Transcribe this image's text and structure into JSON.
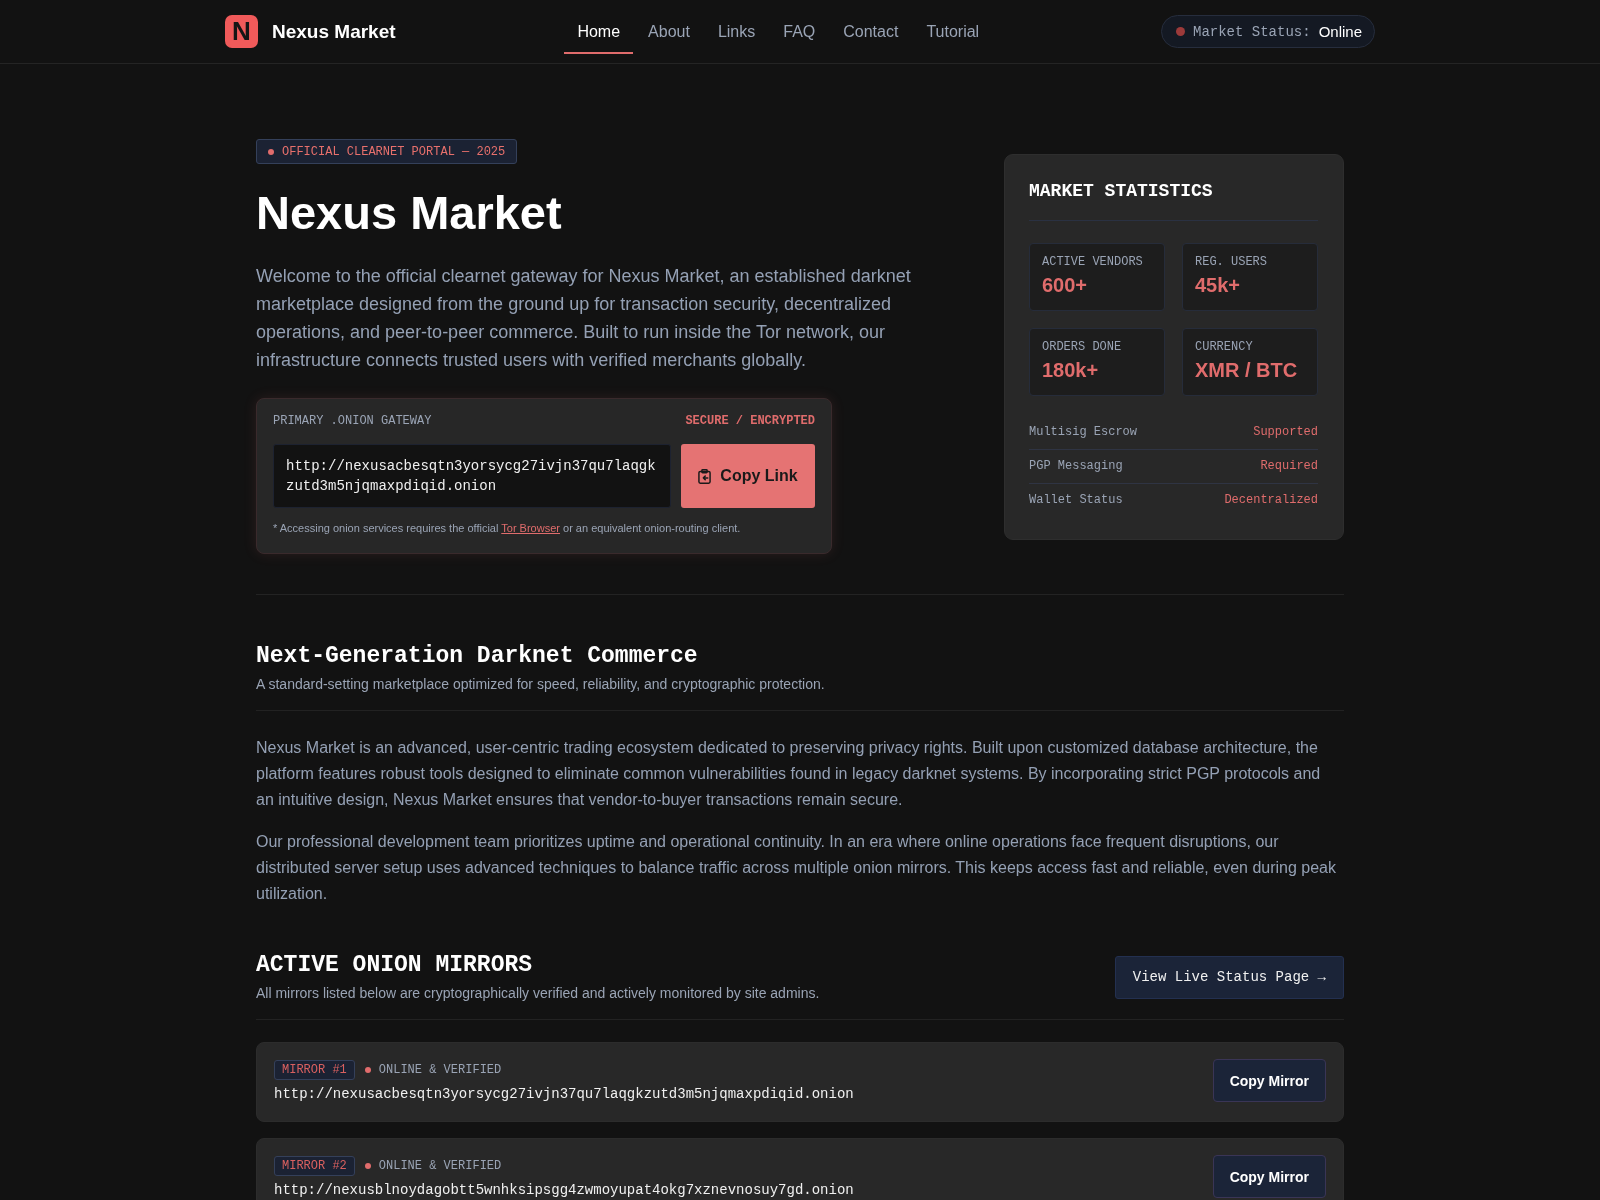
{
  "header": {
    "logo_letter": "N",
    "brand": "Nexus Market",
    "nav": [
      {
        "label": "Home",
        "selected": true
      },
      {
        "label": "About",
        "selected": false
      },
      {
        "label": "Links",
        "selected": false
      },
      {
        "label": "FAQ",
        "selected": false
      },
      {
        "label": "Contact",
        "selected": false
      },
      {
        "label": "Tutorial",
        "selected": false
      }
    ],
    "status": {
      "label": "Market Status:",
      "value": "Online"
    }
  },
  "hero": {
    "badge": "OFFICIAL CLEARNET PORTAL — 2025",
    "title": "Nexus Market",
    "intro": "Welcome to the official clearnet gateway for Nexus Market, an established darknet marketplace designed from the ground up for transaction security, decentralized operations, and peer-to-peer commerce. Built to run inside the Tor network, our infrastructure connects trusted users with verified merchants globally.",
    "gateway": {
      "label": "PRIMARY .ONION GATEWAY",
      "security": "SECURE / ENCRYPTED",
      "url": "http://nexusacbesqtn3yorsycg27ivjn37qu7laqgkzutd3m5njqmaxpdiqid.onion",
      "copy_button": "Copy Link",
      "note": {
        "before": "* Accessing onion services requires the official ",
        "link": "Tor Browser",
        "after": " or an equivalent onion-routing client."
      }
    }
  },
  "stats": {
    "title": "MARKET STATISTICS",
    "tiles": [
      {
        "label": "ACTIVE VENDORS",
        "value": "600+"
      },
      {
        "label": "REG. USERS",
        "value": "45k+"
      },
      {
        "label": "ORDERS DONE",
        "value": "180k+"
      },
      {
        "label": "CURRENCY",
        "value": "XMR / BTC"
      }
    ],
    "features": [
      {
        "label": "Multisig Escrow",
        "value": "Supported"
      },
      {
        "label": "PGP Messaging",
        "value": "Required"
      },
      {
        "label": "Wallet Status",
        "value": "Decentralized"
      }
    ]
  },
  "about": {
    "title": "Next-Generation Darknet Commerce",
    "subtitle": "A standard-setting marketplace optimized for speed, reliability, and cryptographic protection.",
    "paragraphs": [
      "Nexus Market is an advanced, user-centric trading ecosystem dedicated to preserving privacy rights. Built upon customized database architecture, the platform features robust tools designed to eliminate common vulnerabilities found in legacy darknet systems. By incorporating strict PGP protocols and an intuitive design, Nexus Market ensures that vendor-to-buyer transactions remain secure.",
      "Our professional development team prioritizes uptime and operational continuity. In an era where online operations face frequent disruptions, our distributed server setup uses advanced techniques to balance traffic across multiple onion mirrors. This keeps access fast and reliable, even during peak utilization."
    ]
  },
  "mirrors": {
    "title": "ACTIVE ONION MIRRORS",
    "subtitle": "All mirrors listed below are cryptographically verified and actively monitored by site admins.",
    "status_button": "View Live Status Page →",
    "items": [
      {
        "tag": "MIRROR #1",
        "status": "ONLINE & VERIFIED",
        "url": "http://nexusacbesqtn3yorsycg27ivjn37qu7laqgkzutd3m5njqmaxpdiqid.onion",
        "button": "Copy Mirror"
      },
      {
        "tag": "MIRROR #2",
        "status": "ONLINE & VERIFIED",
        "url": "http://nexusblnoydagobtt5wnhksipsgg4zwmoyupat4okg7xznevnosuy7gd.onion",
        "button": "Copy Mirror"
      }
    ]
  }
}
